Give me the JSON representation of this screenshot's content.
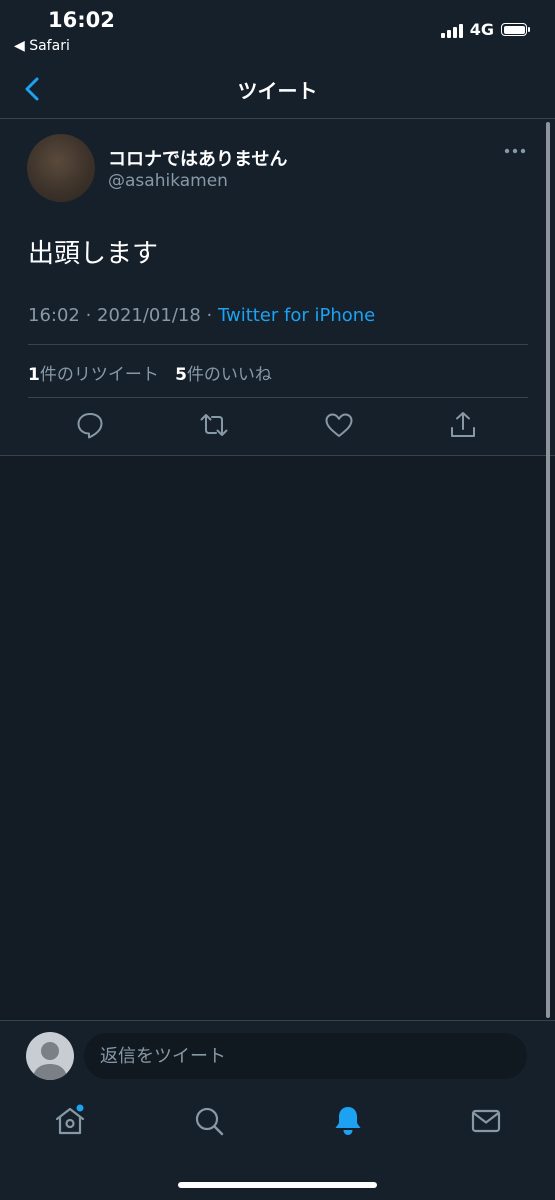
{
  "status_bar": {
    "time": "16:02",
    "back_app": "◀ Safari",
    "network": "4G"
  },
  "nav": {
    "title": "ツイート",
    "back_icon": "chevron-left-icon"
  },
  "tweet": {
    "display_name": "コロナではありません",
    "handle": "@asahikamen",
    "text": "出頭します",
    "timestamp": "16:02 · 2021/01/18 · ",
    "source": "Twitter for iPhone",
    "retweet_count": "1",
    "retweet_label": "件のリツイート",
    "like_count": "5",
    "like_label": "件のいいね",
    "actions": [
      "reply-icon",
      "retweet-icon",
      "like-icon",
      "share-icon"
    ]
  },
  "reply": {
    "placeholder": "返信をツイート"
  },
  "tabbar": {
    "items": [
      "home-icon",
      "search-icon",
      "notifications-icon",
      "messages-icon"
    ],
    "active": "notifications-icon"
  },
  "colors": {
    "background": "#15202b",
    "accent": "#1da1f2",
    "secondary_text": "#8899a6",
    "divider": "#38444d"
  }
}
